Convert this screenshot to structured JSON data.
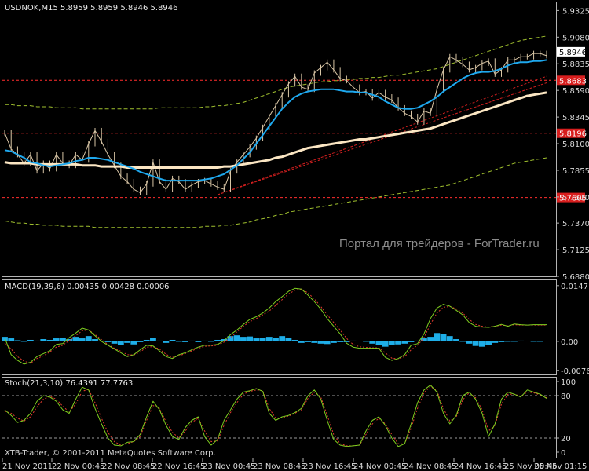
{
  "chart_data": [
    {
      "type": "line",
      "panel": "price",
      "header": {
        "symbol": "USDNOK,M15",
        "open": "5.8959",
        "high": "5.8959",
        "low": "5.8946",
        "close": "5.8946"
      },
      "ylim": [
        5.688,
        5.94
      ],
      "y_ticks": [
        "5.9325",
        "5.9080",
        "5.8835",
        "5.8590",
        "5.8345",
        "5.8100",
        "5.7855",
        "5.7610",
        "5.7370",
        "5.7125",
        "5.6880"
      ],
      "price_label": "5.8946",
      "level_lines": [
        {
          "label": "5.8683",
          "value": 5.8683
        },
        {
          "label": "5.8196",
          "value": 5.8196
        },
        {
          "label": "5.7605",
          "value": 5.7605
        }
      ],
      "price": [
        5.82,
        5.805,
        5.8,
        5.792,
        5.8,
        5.785,
        5.792,
        5.787,
        5.8,
        5.792,
        5.79,
        5.8,
        5.795,
        5.81,
        5.822,
        5.812,
        5.8,
        5.79,
        5.78,
        5.775,
        5.768,
        5.765,
        5.773,
        5.793,
        5.775,
        5.768,
        5.778,
        5.775,
        5.768,
        5.772,
        5.775,
        5.776,
        5.773,
        5.77,
        5.768,
        5.785,
        5.793,
        5.8,
        5.807,
        5.815,
        5.825,
        5.835,
        5.845,
        5.855,
        5.865,
        5.872,
        5.862,
        5.86,
        5.875,
        5.88,
        5.885,
        5.878,
        5.87,
        5.868,
        5.862,
        5.857,
        5.858,
        5.852,
        5.857,
        5.853,
        5.85,
        5.843,
        5.838,
        5.835,
        5.83,
        5.84,
        5.838,
        5.86,
        5.878,
        5.89,
        5.887,
        5.883,
        5.878,
        5.88,
        5.884,
        5.886,
        5.874,
        5.878,
        5.887,
        5.887,
        5.89,
        5.89,
        5.893,
        5.893,
        5.891
      ],
      "ma_fast": [
        5.804,
        5.803,
        5.8,
        5.797,
        5.793,
        5.792,
        5.79,
        5.789,
        5.79,
        5.791,
        5.792,
        5.794,
        5.795,
        5.797,
        5.797,
        5.796,
        5.795,
        5.793,
        5.791,
        5.789,
        5.787,
        5.784,
        5.782,
        5.78,
        5.778,
        5.776,
        5.776,
        5.776,
        5.776,
        5.776,
        5.776,
        5.777,
        5.778,
        5.78,
        5.782,
        5.786,
        5.79,
        5.796,
        5.802,
        5.81,
        5.818,
        5.826,
        5.834,
        5.842,
        5.848,
        5.853,
        5.856,
        5.858,
        5.859,
        5.86,
        5.86,
        5.86,
        5.859,
        5.858,
        5.858,
        5.857,
        5.857,
        5.855,
        5.853,
        5.849,
        5.846,
        5.843,
        5.842,
        5.842,
        5.843,
        5.846,
        5.849,
        5.853,
        5.858,
        5.862,
        5.866,
        5.87,
        5.873,
        5.875,
        5.876,
        5.876,
        5.877,
        5.879,
        5.882,
        5.884,
        5.885,
        5.885,
        5.886,
        5.886,
        5.887
      ],
      "ma_slow": [
        5.793,
        5.792,
        5.792,
        5.792,
        5.792,
        5.791,
        5.791,
        5.791,
        5.791,
        5.791,
        5.791,
        5.791,
        5.79,
        5.79,
        5.79,
        5.789,
        5.789,
        5.789,
        5.789,
        5.788,
        5.788,
        5.788,
        5.788,
        5.788,
        5.788,
        5.788,
        5.788,
        5.788,
        5.788,
        5.788,
        5.788,
        5.788,
        5.788,
        5.788,
        5.789,
        5.789,
        5.79,
        5.791,
        5.792,
        5.793,
        5.794,
        5.795,
        5.797,
        5.798,
        5.8,
        5.802,
        5.804,
        5.806,
        5.807,
        5.808,
        5.809,
        5.81,
        5.811,
        5.812,
        5.813,
        5.814,
        5.814,
        5.815,
        5.816,
        5.817,
        5.818,
        5.819,
        5.82,
        5.821,
        5.822,
        5.823,
        5.824,
        5.826,
        5.828,
        5.83,
        5.832,
        5.834,
        5.836,
        5.838,
        5.84,
        5.842,
        5.844,
        5.846,
        5.848,
        5.85,
        5.852,
        5.854,
        5.855,
        5.856,
        5.857
      ],
      "env_upper": [
        5.846,
        5.846,
        5.845,
        5.845,
        5.845,
        5.844,
        5.844,
        5.844,
        5.843,
        5.843,
        5.843,
        5.843,
        5.842,
        5.842,
        5.842,
        5.842,
        5.842,
        5.842,
        5.842,
        5.842,
        5.842,
        5.842,
        5.842,
        5.842,
        5.843,
        5.843,
        5.843,
        5.843,
        5.843,
        5.843,
        5.843,
        5.844,
        5.844,
        5.845,
        5.845,
        5.846,
        5.847,
        5.848,
        5.85,
        5.852,
        5.854,
        5.856,
        5.858,
        5.86,
        5.862,
        5.863,
        5.864,
        5.865,
        5.866,
        5.867,
        5.867,
        5.868,
        5.868,
        5.869,
        5.869,
        5.87,
        5.87,
        5.871,
        5.871,
        5.872,
        5.873,
        5.873,
        5.874,
        5.875,
        5.876,
        5.877,
        5.878,
        5.879,
        5.881,
        5.883,
        5.885,
        5.887,
        5.889,
        5.891,
        5.893,
        5.895,
        5.897,
        5.899,
        5.901,
        5.903,
        5.905,
        5.906,
        5.907,
        5.908,
        5.909
      ],
      "env_lower": [
        5.739,
        5.738,
        5.737,
        5.737,
        5.736,
        5.736,
        5.735,
        5.735,
        5.735,
        5.734,
        5.734,
        5.734,
        5.734,
        5.734,
        5.733,
        5.733,
        5.733,
        5.733,
        5.733,
        5.733,
        5.733,
        5.733,
        5.733,
        5.733,
        5.733,
        5.733,
        5.733,
        5.733,
        5.733,
        5.733,
        5.733,
        5.734,
        5.734,
        5.734,
        5.735,
        5.735,
        5.736,
        5.737,
        5.738,
        5.74,
        5.741,
        5.742,
        5.744,
        5.745,
        5.747,
        5.748,
        5.749,
        5.75,
        5.751,
        5.752,
        5.753,
        5.754,
        5.755,
        5.756,
        5.757,
        5.758,
        5.759,
        5.76,
        5.761,
        5.762,
        5.763,
        5.764,
        5.765,
        5.766,
        5.767,
        5.768,
        5.769,
        5.77,
        5.771,
        5.772,
        5.774,
        5.776,
        5.778,
        5.78,
        5.782,
        5.784,
        5.786,
        5.788,
        5.79,
        5.792,
        5.793,
        5.794,
        5.795,
        5.796,
        5.797
      ],
      "trend_lines": [
        {
          "from": [
            33,
            5.763
          ],
          "to": [
            84,
            5.866
          ]
        },
        {
          "from": [
            33,
            5.763
          ],
          "to": [
            84,
            5.872
          ]
        }
      ],
      "watermark": "Портал для трейдеров - ForTrader.ru",
      "colors": {
        "price": "#d9c6a6",
        "ma_fast": "#1ea8ee",
        "ma_slow": "#fbe6c3",
        "envelope": "#9fbf2e",
        "level": "#ff2e2e",
        "trend": "#d21f1f"
      }
    },
    {
      "type": "bar",
      "panel": "macd",
      "label": "MACD(19,39,6) 0.00435 0.00428 0.00006",
      "ylim": [
        -0.0085,
        0.0155
      ],
      "y_ticks": [
        "0.01471",
        "0.00",
        "-0.00763"
      ],
      "histogram": [
        0.0012,
        0.0008,
        0.0003,
        0.0,
        0.0004,
        0.0002,
        0.0006,
        0.0004,
        0.0008,
        0.001,
        0.0006,
        0.0012,
        0.0008,
        0.0014,
        0.0006,
        0.0002,
        -0.0002,
        -0.0006,
        -0.001,
        -0.0004,
        -0.0008,
        -0.0002,
        0.0004,
        0.001,
        0.0002,
        -0.0004,
        0.0004,
        0.0,
        -0.0002,
        0.0002,
        -0.0002,
        0.0002,
        0.0,
        0.0004,
        0.0006,
        0.0014,
        0.0016,
        0.0012,
        0.0013,
        0.0008,
        0.001,
        0.0012,
        0.0009,
        0.0014,
        0.001,
        0.0004,
        -0.0004,
        -0.0002,
        -0.0004,
        -0.0006,
        -0.0007,
        -0.0004,
        -0.0002,
        -0.0002,
        0.0002,
        0.0001,
        -0.0001,
        -0.0006,
        -0.001,
        -0.0014,
        -0.001,
        -0.0008,
        -0.0006,
        -0.0002,
        0.0002,
        0.0008,
        0.0012,
        0.0022,
        0.002,
        0.0014,
        0.0006,
        0.0,
        -0.0006,
        -0.0012,
        -0.0014,
        -0.001,
        -0.0004,
        -0.0002,
        0.0,
        0.0,
        0.0002,
        0.0001,
        0.0,
        0.0,
        0.0001
      ],
      "main": [
        0.001,
        -0.0035,
        -0.005,
        -0.006,
        -0.0055,
        -0.004,
        -0.0032,
        -0.0025,
        -0.0008,
        -0.0006,
        0.001,
        0.0022,
        0.0035,
        0.003,
        0.0015,
        0.0,
        -0.001,
        -0.002,
        -0.003,
        -0.004,
        -0.0035,
        -0.0022,
        -0.001,
        -0.0012,
        -0.0025,
        -0.004,
        -0.0045,
        -0.0035,
        -0.003,
        -0.0022,
        -0.0015,
        -0.001,
        -0.001,
        -0.0008,
        0.0002,
        0.0018,
        0.003,
        0.0045,
        0.0058,
        0.0065,
        0.0075,
        0.0088,
        0.0105,
        0.0118,
        0.0132,
        0.014,
        0.0138,
        0.0122,
        0.0105,
        0.0085,
        0.006,
        0.004,
        0.002,
        -0.0005,
        -0.0015,
        -0.0018,
        -0.0018,
        -0.0018,
        -0.0018,
        -0.0042,
        -0.005,
        -0.0045,
        -0.0035,
        -0.001,
        -0.0006,
        0.002,
        0.006,
        0.0088,
        0.0098,
        0.0093,
        0.0082,
        0.007,
        0.005,
        0.004,
        0.0038,
        0.0037,
        0.004,
        0.0045,
        0.004,
        0.0046,
        0.0044,
        0.0043,
        0.0044,
        0.0044,
        0.0044
      ],
      "signal": [
        -0.0005,
        -0.002,
        -0.004,
        -0.0052,
        -0.0058,
        -0.0045,
        -0.0038,
        -0.0028,
        -0.0015,
        -0.001,
        0.0002,
        0.0015,
        0.0028,
        0.003,
        0.0018,
        0.0005,
        -0.0008,
        -0.0018,
        -0.0026,
        -0.0035,
        -0.0036,
        -0.0028,
        -0.0015,
        -0.0014,
        -0.002,
        -0.0034,
        -0.0042,
        -0.0038,
        -0.0032,
        -0.0025,
        -0.0018,
        -0.0013,
        -0.0012,
        -0.001,
        -0.0002,
        0.001,
        0.0025,
        0.004,
        0.0052,
        0.006,
        0.007,
        0.008,
        0.0095,
        0.011,
        0.0125,
        0.0135,
        0.0138,
        0.0128,
        0.0112,
        0.0092,
        0.007,
        0.005,
        0.003,
        0.0008,
        -0.0008,
        -0.0014,
        -0.0016,
        -0.0017,
        -0.0017,
        -0.003,
        -0.0044,
        -0.0046,
        -0.004,
        -0.0022,
        -0.001,
        0.001,
        0.0045,
        0.0075,
        0.009,
        0.0092,
        0.0086,
        0.0075,
        0.0058,
        0.0045,
        0.004,
        0.0038,
        0.004,
        0.0043,
        0.0041,
        0.0044,
        0.0043,
        0.0043,
        0.0043,
        0.0043,
        0.0043
      ],
      "colors": {
        "histogram": "#1eaee8",
        "main": "#7fcf1f",
        "signal": "#e23b2e"
      }
    },
    {
      "type": "line",
      "panel": "stochastic",
      "label": "Stoch(21,3,10) 76.4391 77.7763",
      "ylim": [
        0,
        100
      ],
      "y_ticks": [
        "100",
        "80",
        "20",
        "0"
      ],
      "levels": [
        80,
        20
      ],
      "main": [
        60,
        52,
        42,
        45,
        55,
        72,
        80,
        78,
        72,
        60,
        55,
        75,
        92,
        88,
        62,
        40,
        20,
        10,
        9,
        14,
        15,
        25,
        50,
        72,
        60,
        38,
        22,
        18,
        35,
        45,
        50,
        22,
        10,
        18,
        45,
        60,
        75,
        85,
        87,
        90,
        86,
        55,
        45,
        50,
        52,
        56,
        62,
        80,
        88,
        75,
        45,
        18,
        10,
        8,
        9,
        10,
        30,
        45,
        50,
        38,
        20,
        8,
        12,
        40,
        70,
        88,
        95,
        85,
        55,
        40,
        52,
        80,
        85,
        75,
        55,
        22,
        40,
        75,
        85,
        82,
        78,
        88,
        85,
        82,
        76
      ],
      "signal": [
        58,
        55,
        48,
        44,
        50,
        64,
        75,
        79,
        75,
        65,
        57,
        68,
        86,
        89,
        70,
        48,
        28,
        15,
        10,
        12,
        15,
        22,
        45,
        66,
        62,
        43,
        28,
        20,
        30,
        42,
        48,
        30,
        15,
        16,
        38,
        56,
        70,
        82,
        86,
        88,
        87,
        62,
        48,
        49,
        51,
        55,
        60,
        76,
        85,
        78,
        52,
        25,
        12,
        9,
        9,
        10,
        25,
        40,
        48,
        40,
        25,
        12,
        12,
        34,
        62,
        84,
        93,
        87,
        62,
        44,
        50,
        74,
        84,
        77,
        60,
        30,
        38,
        68,
        82,
        82,
        79,
        85,
        84,
        81,
        77
      ],
      "colors": {
        "main": "#7fcf1f",
        "signal": "#e23b2e",
        "level": "#9a9a9a"
      }
    }
  ],
  "x_ticks": [
    "21 Nov 2011",
    "22 Nov 00:45",
    "22 Nov 08:45",
    "22 Nov 16:45",
    "23 Nov 00:45",
    "23 Nov 08:45",
    "23 Nov 16:45",
    "24 Nov 00:45",
    "24 Nov 08:45",
    "24 Nov 16:45",
    "25 Nov 00:45",
    "25 Nov 01:15"
  ],
  "copyright": "XTB-Trader, © 2001-2011 MetaQuotes Software Corp."
}
